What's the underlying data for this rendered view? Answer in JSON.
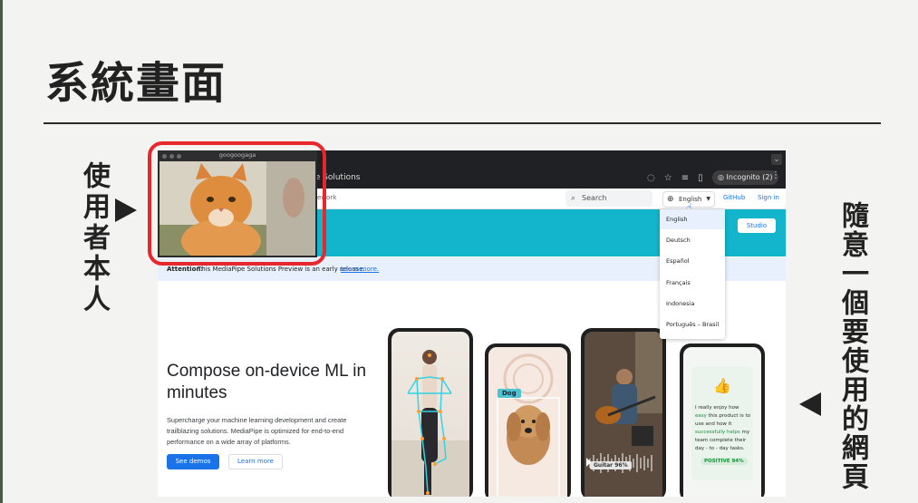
{
  "slide": {
    "title": "系統畫面",
    "label_left": "使用者本人",
    "label_right": "隨意一個要使用的網頁"
  },
  "camera_window": {
    "title": "googoogaga"
  },
  "browser": {
    "tab_chevron": "⌄",
    "url_fragment": "pe Solutions",
    "incognito_label": "Incognito (2)",
    "breadcrumb_fragment": "ework",
    "search_placeholder": "Search",
    "language_selected": "English",
    "header_links": [
      "GitHub",
      "Sign in"
    ],
    "studio_button": "Studio",
    "attention_label": "Attention:",
    "attention_text": "This MediaPipe Solutions Preview is an early release.",
    "attention_link": "Learn more.",
    "language_options": [
      "English",
      "Deutsch",
      "Español",
      "Français",
      "Indonesia",
      "Português – Brasil"
    ],
    "hero_title": "Compose on-device ML in minutes",
    "hero_description": "Supercharge your machine learning development and create trailblazing solutions. MediaPipe is optimized for end-to-end performance on a wide array of platforms.",
    "see_demos_button": "See demos",
    "learn_more_button": "Learn more",
    "phones": {
      "dog_label": "Dog",
      "guitar_label": "Guitar",
      "guitar_score": "96%",
      "review_pre1": "I really enjoy how ",
      "review_hl1": "easy",
      "review_mid1": " this product is to use and how it ",
      "review_hl2": "successfully helps",
      "review_end": " my team complete their day - to - day tasks.",
      "sentiment_badge": "POSITIVE 94%"
    }
  },
  "colors": {
    "highlight_frame": "#e8272d",
    "banner": "#12b5cb",
    "primary_button": "#1a73e8"
  }
}
